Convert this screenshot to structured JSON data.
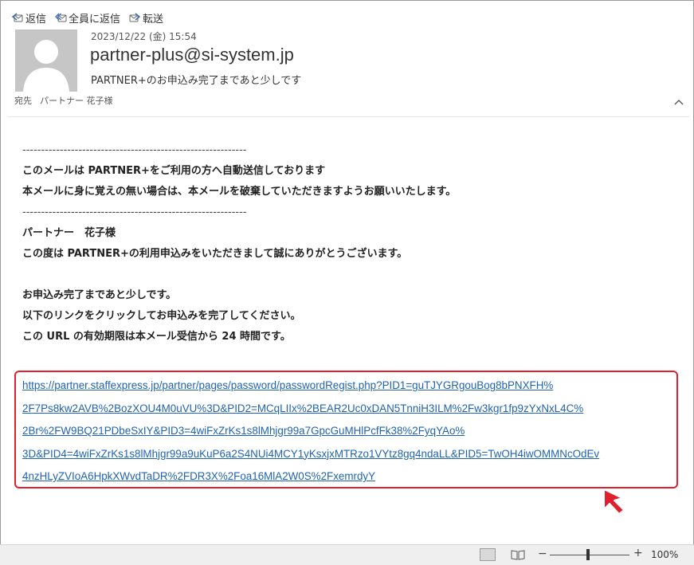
{
  "toolbar": {
    "reply_label": "返信",
    "reply_all_label": "全員に返信",
    "forward_label": "転送"
  },
  "header": {
    "datetime": "2023/12/22 (金) 15:54",
    "sender": "partner-plus@si-system.jp",
    "subject": "PARTNER+のお申込み完了まであと少しです",
    "to_label": "宛先",
    "to_value": "パートナー 花子様"
  },
  "body": {
    "separator": "------------------------------------------------------------",
    "lines": [
      "このメールは PARTNER+をご利用の方へ自動送信しております",
      "本メールに身に覚えの無い場合は、本メールを破棄していただきますようお願いいたします。",
      "パートナー　花子様",
      "この度は PARTNER+の利用申込みをいただきまして誠にありがとうございます。",
      "お申込み完了まであと少しです。",
      "以下のリンクをクリックしてお申込みを完了してください。",
      "この URL の有効期限は本メール受信から 24 時間です。"
    ],
    "link_lines": [
      "https://partner.staffexpress.jp/partner/pages/password/passwordRegist.php?PID1=guTJYGRgouBog8bPNXFH%",
      "2F7Ps8kw2AVB%2BozXOU4M0uVU%3D&PID2=MCqLIIx%2BEAR2Uc0xDAN5TnniH3ILM%2Fw3kgr1fp9zYxNxL4C%",
      "2Br%2FW9BQ21PDbeSxIY&PID3=4wiFxZrKs1s8lMhjgr99a7GpcGuMHlPcfFk38%2FyqYAo%",
      "3D&PID4=4wiFxZrKs1s8lMhjgr99a9uKuP6a2S4NUi4MCY1yKsxjxMTRzo1VYtz8gq4ndaLL&PID5=TwOH4iwOMMNcOdEv",
      "4nzHLyZVIoA6HpkXWvdTaDR%2FDR3X%2Foa16MlA2W0S%2FxemrdyY"
    ]
  },
  "statusbar": {
    "zoom_minus": "−",
    "zoom_plus": "+",
    "zoom_level": "100%",
    "zoom_value": 100
  },
  "colors": {
    "link": "#1f63b5",
    "highlight_border": "#e0202e",
    "arrow": "#e0202e"
  }
}
